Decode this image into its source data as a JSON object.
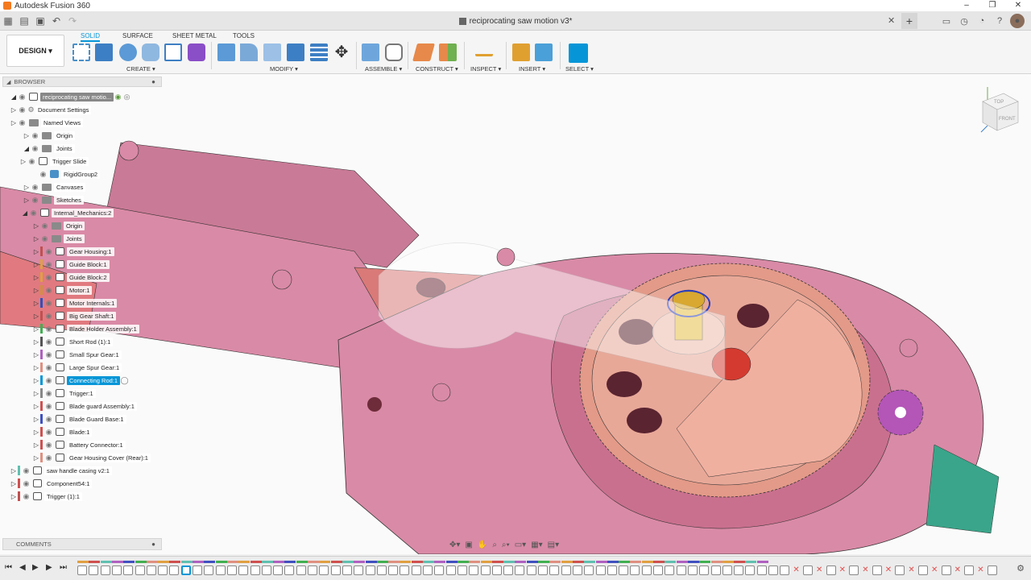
{
  "window": {
    "title": "Autodesk Fusion 360",
    "controls": [
      "–",
      "❐",
      "✕"
    ]
  },
  "document": {
    "tab_title": "reciprocating saw motion v3*",
    "close": "✕",
    "new_tab": "+"
  },
  "quick_access": [
    "grid-icon",
    "file-icon",
    "save-icon",
    "undo-icon",
    "redo-icon"
  ],
  "toolbar": {
    "workspace": "DESIGN ▾",
    "tabs": [
      {
        "label": "SOLID",
        "active": true
      },
      {
        "label": "SURFACE",
        "active": false
      },
      {
        "label": "SHEET METAL",
        "active": false
      },
      {
        "label": "TOOLS",
        "active": false
      }
    ],
    "groups": [
      {
        "label": "CREATE ▾"
      },
      {
        "label": "MODIFY ▾"
      },
      {
        "label": "ASSEMBLE ▾"
      },
      {
        "label": "CONSTRUCT ▾"
      },
      {
        "label": "INSPECT ▾"
      },
      {
        "label": "INSERT ▾"
      },
      {
        "label": "SELECT ▾"
      }
    ]
  },
  "browser": {
    "header": "BROWSER",
    "root": "reciprocating saw motio...",
    "items": [
      {
        "label": "Document Settings"
      },
      {
        "label": "Named Views"
      },
      {
        "label": "Origin"
      },
      {
        "label": "Joints"
      },
      {
        "label": "Trigger Slide"
      },
      {
        "label": "RigidGroup2"
      },
      {
        "label": "Canvases"
      },
      {
        "label": "Sketches"
      },
      {
        "label": "Internal_Mechanics:2"
      },
      {
        "label": "Origin"
      },
      {
        "label": "Joints"
      },
      {
        "label": "Gear Housing:1"
      },
      {
        "label": "Guide Block:1"
      },
      {
        "label": "Guide Block:2"
      },
      {
        "label": "Motor:1"
      },
      {
        "label": "Motor Internals:1"
      },
      {
        "label": "Big Gear Shaft:1"
      },
      {
        "label": "Blade Holder Assembly:1"
      },
      {
        "label": "Short Rod (1):1"
      },
      {
        "label": "Small Spur Gear:1"
      },
      {
        "label": "Large Spur Gear:1"
      },
      {
        "label": "Connecting Rod:1"
      },
      {
        "label": "Trigger:1"
      },
      {
        "label": "Blade guard Assembly:1"
      },
      {
        "label": "Blade Guard Base:1"
      },
      {
        "label": "Blade:1"
      },
      {
        "label": "Battery Connector:1"
      },
      {
        "label": "Gear Housing Cover (Rear):1"
      },
      {
        "label": "saw handle casing v2:1"
      },
      {
        "label": "Component54:1"
      },
      {
        "label": "Trigger (1):1"
      }
    ]
  },
  "viewcube": {
    "top": "TOP",
    "front": "FRONT"
  },
  "comments": {
    "label": "COMMENTS"
  },
  "colors": {
    "accent": "#0696d7",
    "housing": "#d98aa6",
    "gear": "#e3a08f"
  }
}
